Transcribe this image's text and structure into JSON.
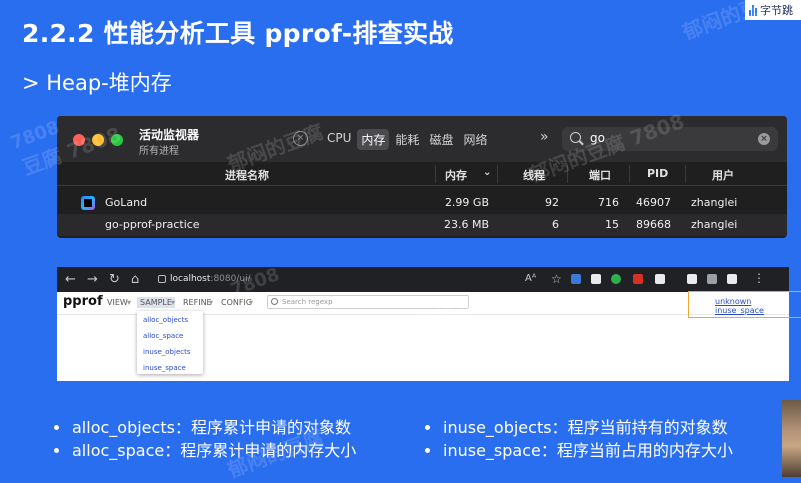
{
  "slide": {
    "title": "2.2.2 性能分析工具 pprof-排查实战",
    "subtitle": "> Heap-堆内存",
    "logo_text": "字节跳",
    "watermarks": [
      "郁闷的豆腐",
      "7808",
      "郁闷的豆腐 7808",
      "豆腐 7808",
      "郁闷的豆腐",
      "7808",
      "郁闷的豆腐",
      "郁闷的豆腐"
    ],
    "bullets": [
      {
        "term": "alloc_objects",
        "desc": "程序累计申请的对象数"
      },
      {
        "term": "alloc_space",
        "desc": "程序累计申请的内存大小"
      },
      {
        "term": "inuse_objects",
        "desc": "程序当前持有的对象数"
      },
      {
        "term": "inuse_space",
        "desc": "程序当前占用的内存大小"
      }
    ],
    "bullet_separator": "："
  },
  "activity_monitor": {
    "title": "活动监视器",
    "subtitle": "所有进程",
    "close_symbol": "×",
    "tabs": [
      "CPU",
      "内存",
      "能耗",
      "磁盘",
      "网络"
    ],
    "active_tab": "内存",
    "overflow_symbol": "»",
    "search_value": "go",
    "clear_symbol": "×",
    "columns": {
      "name": "进程名称",
      "memory": "内存",
      "threads": "线程",
      "ports": "端口",
      "pid": "PID",
      "user": "用户"
    },
    "sort_indicator": "⌄",
    "rows": [
      {
        "name": "GoLand",
        "memory": "2.99 GB",
        "threads": "92",
        "ports": "716",
        "pid": "46907",
        "user": "zhanglei"
      },
      {
        "name": "go-pprof-practice",
        "memory": "23.6 MB",
        "threads": "6",
        "ports": "15",
        "pid": "89668",
        "user": "zhanglei"
      }
    ]
  },
  "browser": {
    "back": "←",
    "forward": "→",
    "reload": "↻",
    "home": "⌂",
    "host": "localhost",
    "path": ":8080/ui/",
    "reader_icon": "Aᴬ",
    "star_icon": "☆",
    "extension_colors": [
      "#3c78d8",
      "#e8eaed",
      "#1e8e3e",
      "#2bb24c",
      "#d93025",
      "#e8eaed",
      "#e8eaed",
      "#e8eaed"
    ],
    "pprof": {
      "logo": "pprof",
      "menus": [
        "VIEW",
        "SAMPLE",
        "REFINE",
        "CONFIG"
      ],
      "active_menu": "SAMPLE",
      "caret": "▾",
      "search_placeholder": "Search regexp",
      "current_sample": "unknown inuse_space",
      "sample_options": [
        "alloc_objects",
        "alloc_space",
        "inuse_objects",
        "inuse_space"
      ]
    }
  },
  "colors": {
    "slide_bg": "#2a6ef0",
    "tl_red": "#fe5f57",
    "tl_yellow": "#febc2e",
    "tl_green": "#28c840",
    "highlight": "#f0a830"
  }
}
